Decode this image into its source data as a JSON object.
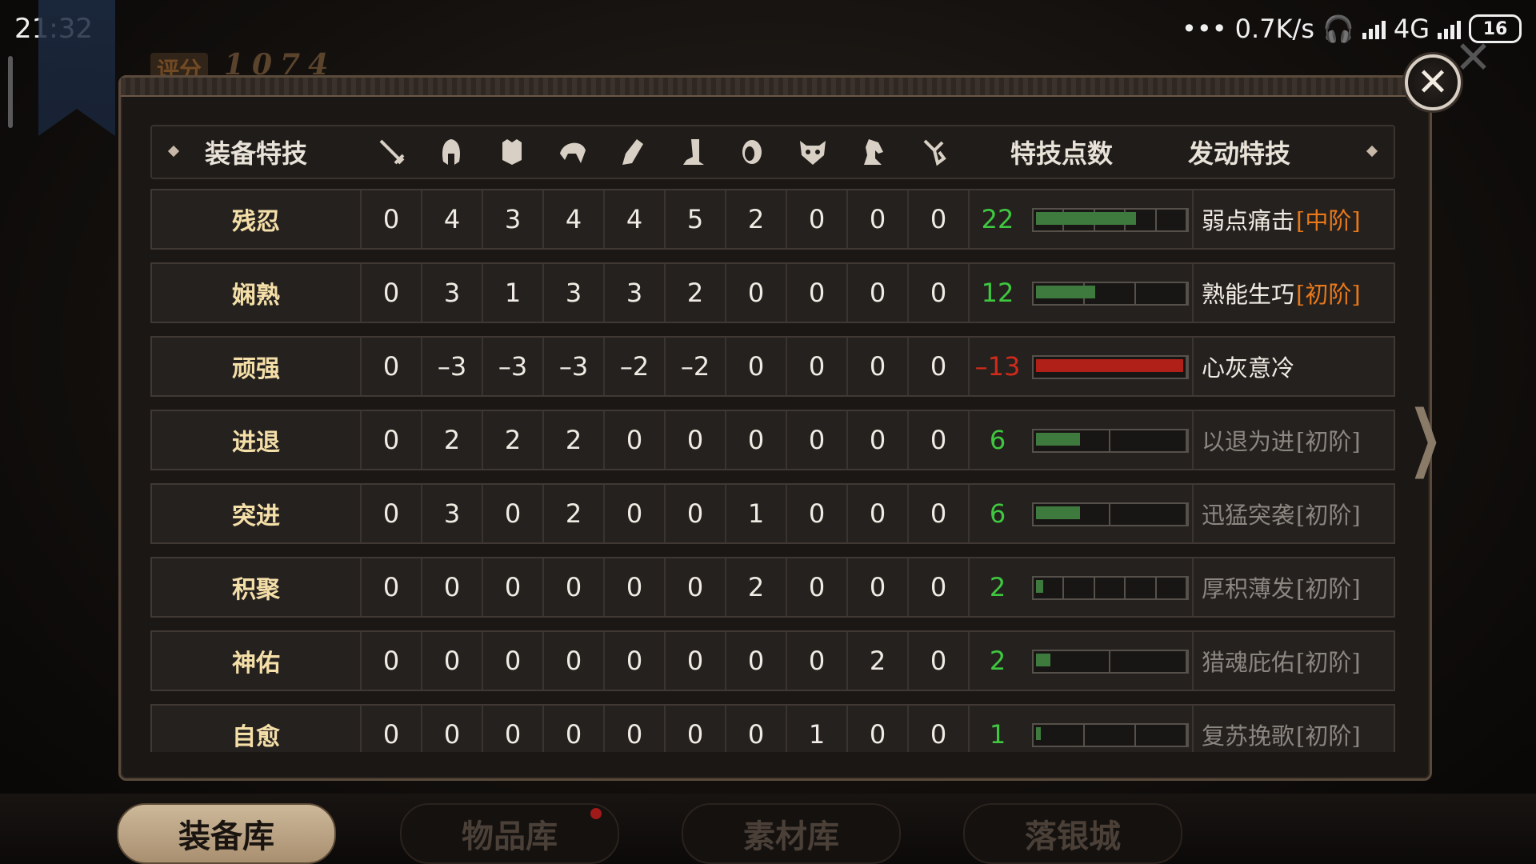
{
  "status_bar": {
    "time": "21:32",
    "net_speed": "0.7K/s",
    "network": "4G",
    "battery": "16"
  },
  "background": {
    "score_label": "评分",
    "score_value": "1074"
  },
  "header": {
    "title": "装备特技",
    "points_label": "特技点数",
    "active_label": "发动特技",
    "slot_icons": [
      "sword-icon",
      "helmet-icon",
      "armor-icon",
      "shoulder-icon",
      "glove-icon",
      "boot-icon",
      "ring-icon",
      "mask-icon",
      "horse-icon",
      "charm-icon"
    ]
  },
  "rows": [
    {
      "name": "残忍",
      "values": [
        "0",
        "4",
        "3",
        "4",
        "4",
        "5",
        "2",
        "0",
        "0",
        "0"
      ],
      "points": "22",
      "segments": 5,
      "fill": 0.68,
      "skill": "弱点痛击",
      "level": "[中阶]",
      "active": true,
      "negative": false
    },
    {
      "name": "娴熟",
      "values": [
        "0",
        "3",
        "1",
        "3",
        "3",
        "2",
        "0",
        "0",
        "0",
        "0"
      ],
      "points": "12",
      "segments": 3,
      "fill": 0.4,
      "skill": "熟能生巧",
      "level": "[初阶]",
      "active": true,
      "negative": false
    },
    {
      "name": "顽强",
      "values": [
        "0",
        "–3",
        "–3",
        "–3",
        "–2",
        "–2",
        "0",
        "0",
        "0",
        "0"
      ],
      "points": "–13",
      "segments": 1,
      "fill": 1.0,
      "skill": "心灰意冷",
      "level": "",
      "active": true,
      "negative": true
    },
    {
      "name": "进退",
      "values": [
        "0",
        "2",
        "2",
        "2",
        "0",
        "0",
        "0",
        "0",
        "0",
        "0"
      ],
      "points": "6",
      "segments": 2,
      "fill": 0.3,
      "skill": "以退为进",
      "level": "[初阶]",
      "active": false,
      "negative": false
    },
    {
      "name": "突进",
      "values": [
        "0",
        "3",
        "0",
        "2",
        "0",
        "0",
        "1",
        "0",
        "0",
        "0"
      ],
      "points": "6",
      "segments": 2,
      "fill": 0.3,
      "skill": "迅猛突袭",
      "level": "[初阶]",
      "active": false,
      "negative": false
    },
    {
      "name": "积聚",
      "values": [
        "0",
        "0",
        "0",
        "0",
        "0",
        "0",
        "2",
        "0",
        "0",
        "0"
      ],
      "points": "2",
      "segments": 5,
      "fill": 0.05,
      "skill": "厚积薄发",
      "level": "[初阶]",
      "active": false,
      "negative": false
    },
    {
      "name": "神佑",
      "values": [
        "0",
        "0",
        "0",
        "0",
        "0",
        "0",
        "0",
        "0",
        "2",
        "0"
      ],
      "points": "2",
      "segments": 2,
      "fill": 0.1,
      "skill": "猎魂庇佑",
      "level": "[初阶]",
      "active": false,
      "negative": false
    },
    {
      "name": "自愈",
      "values": [
        "0",
        "0",
        "0",
        "0",
        "0",
        "0",
        "0",
        "1",
        "0",
        "0"
      ],
      "points": "1",
      "segments": 3,
      "fill": 0.03,
      "skill": "复苏挽歌",
      "level": "[初阶]",
      "active": false,
      "negative": false
    }
  ],
  "bottom_tabs": [
    {
      "label": "装备库",
      "active": true
    },
    {
      "label": "物品库",
      "active": false
    },
    {
      "label": "素材库",
      "active": false
    },
    {
      "label": "落银城",
      "active": false
    }
  ],
  "colors": {
    "positive": "#3fc83f",
    "negative": "#d02a1a",
    "gold": "#f5dfa8",
    "level_orange": "#e8781a",
    "inactive_skill": "#8c8680",
    "bar_green": "#3e7a3e",
    "bar_red": "#b02018"
  }
}
